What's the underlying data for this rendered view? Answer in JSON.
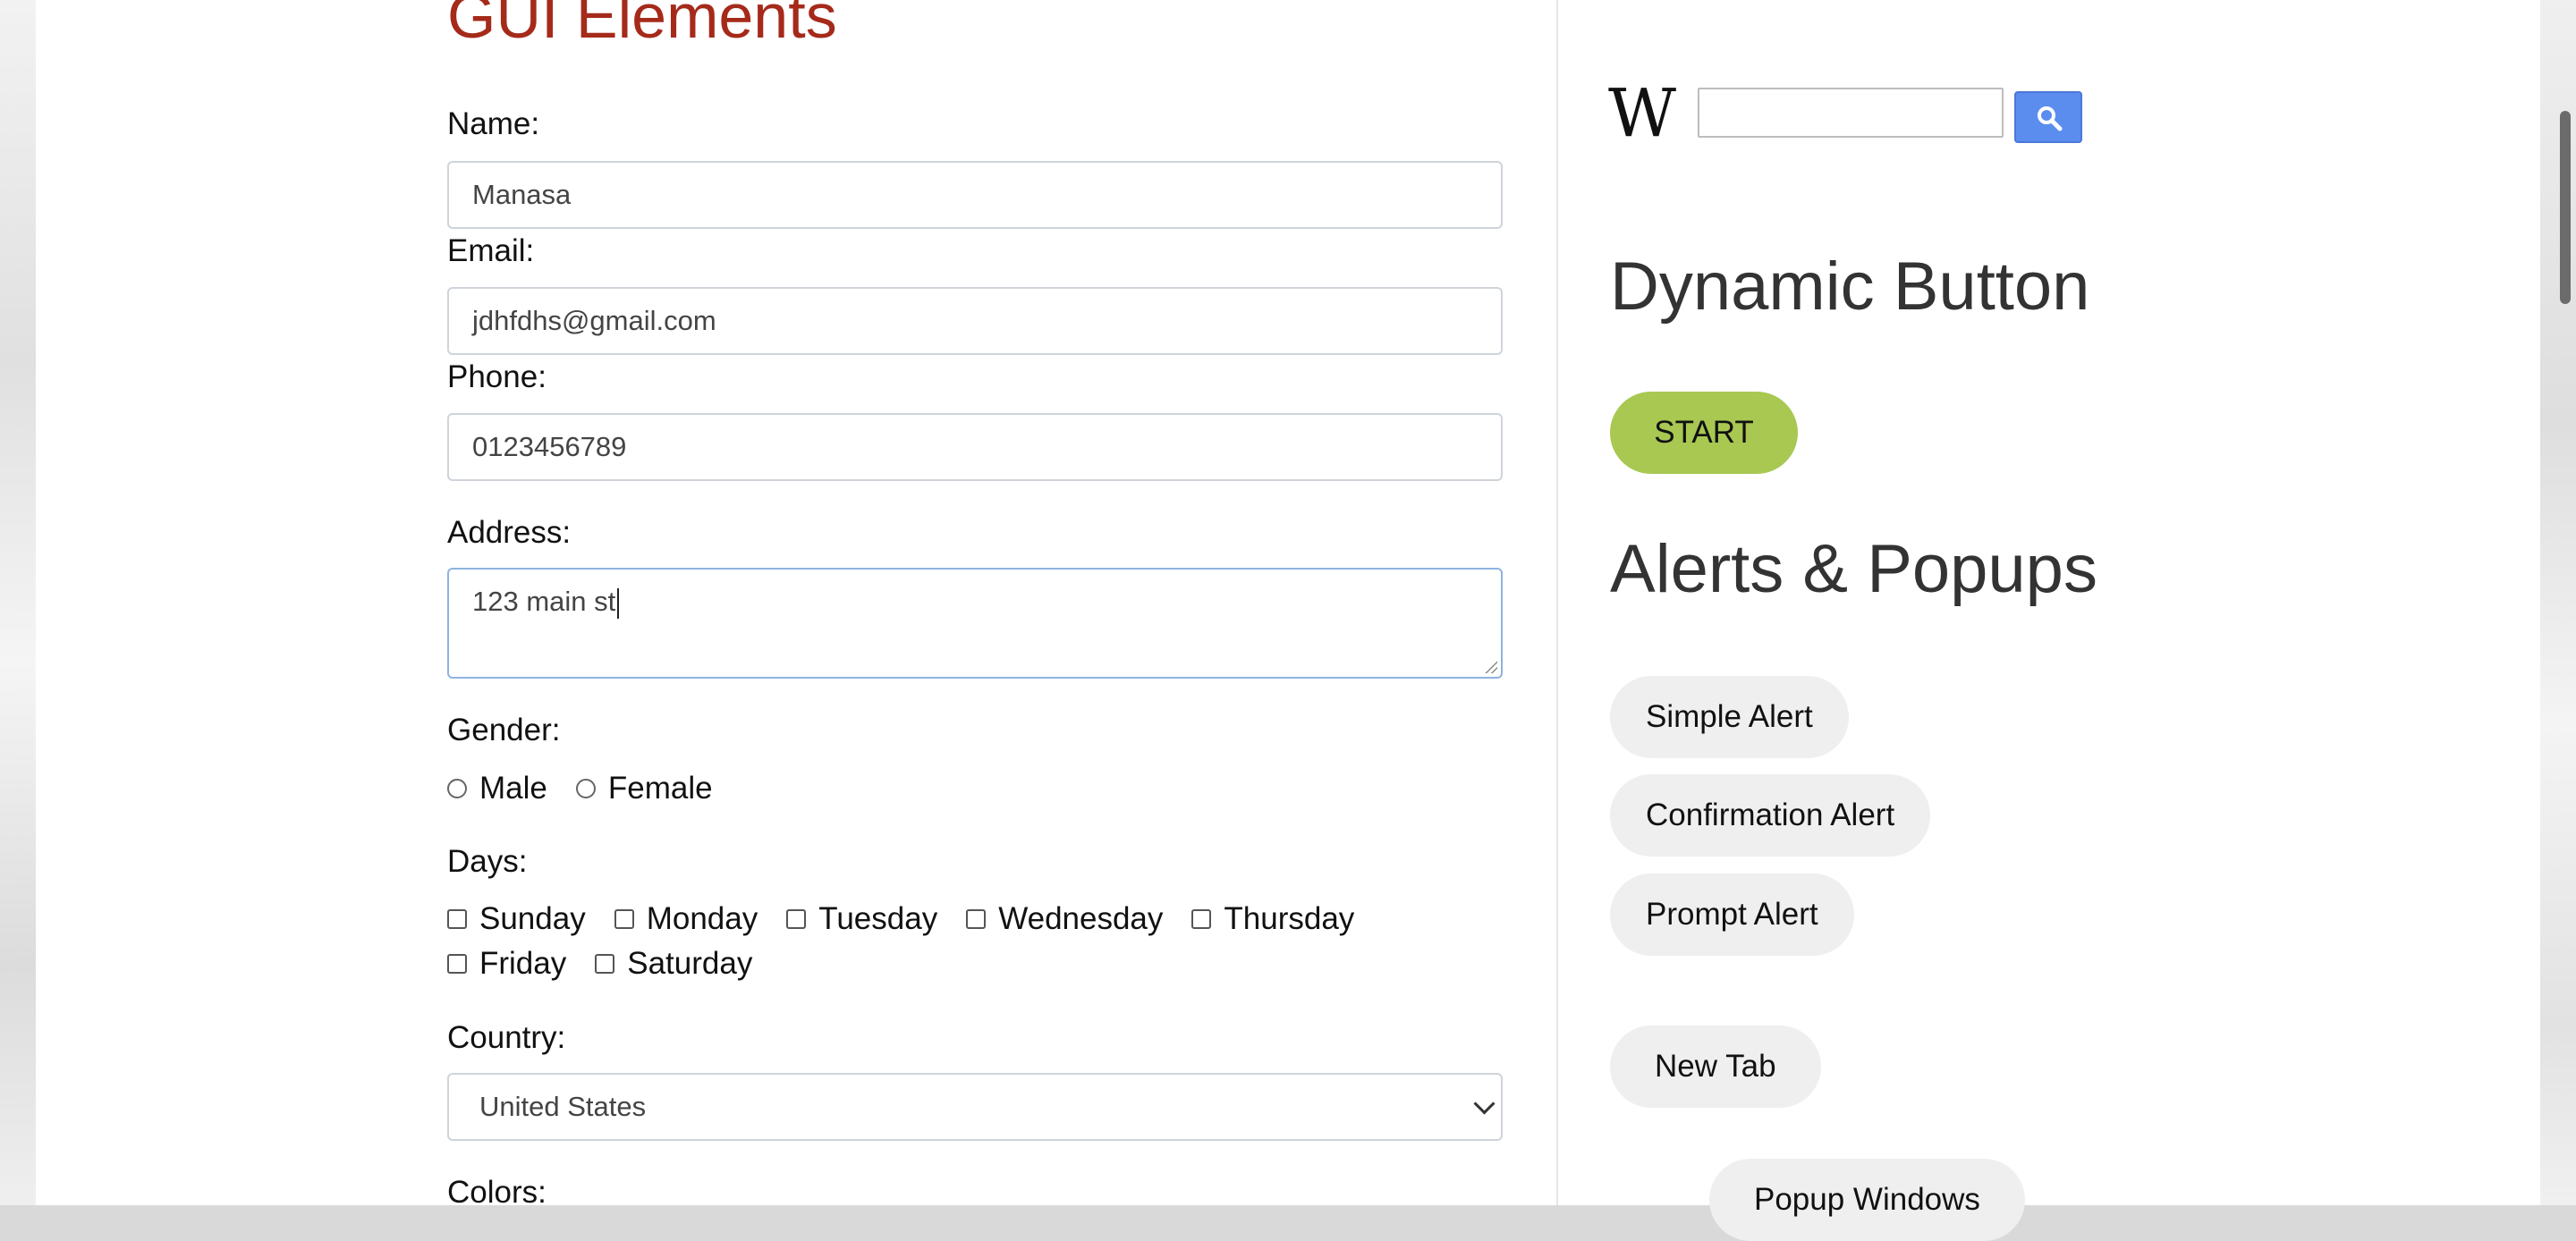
{
  "page": {
    "title": "GUI Elements"
  },
  "form": {
    "name": {
      "label": "Name:",
      "value": "Manasa"
    },
    "email": {
      "label": "Email:",
      "value": "jdhfdhs@gmail.com"
    },
    "phone": {
      "label": "Phone:",
      "value": "0123456789"
    },
    "address": {
      "label": "Address:",
      "value": "123 main st"
    },
    "gender": {
      "label": "Gender:",
      "options": [
        "Male",
        "Female"
      ]
    },
    "days": {
      "label": "Days:",
      "options": [
        "Sunday",
        "Monday",
        "Tuesday",
        "Wednesday",
        "Thursday",
        "Friday",
        "Saturday"
      ]
    },
    "country": {
      "label": "Country:",
      "selected": "United States"
    },
    "colors": {
      "label": "Colors:"
    }
  },
  "sidebar": {
    "wiki": {
      "logo": "W",
      "icon": "search-icon"
    },
    "dynamic_button": {
      "heading": "Dynamic Button",
      "button_label": "START"
    },
    "alerts": {
      "heading": "Alerts & Popups",
      "simple": "Simple Alert",
      "confirmation": "Confirmation Alert",
      "prompt": "Prompt Alert"
    },
    "new_tab": "New Tab",
    "popup_windows": "Popup Windows"
  },
  "colors": {
    "title": "#a52a1a",
    "start_button": "#a8c852",
    "search_button": "#5b8def"
  }
}
